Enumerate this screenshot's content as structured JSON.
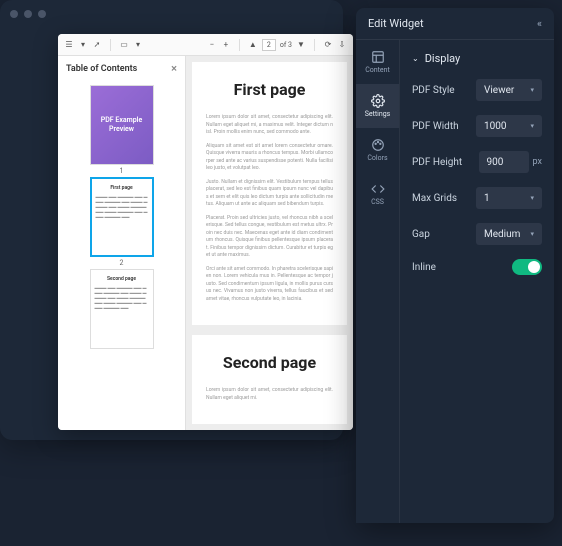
{
  "pdf_viewer": {
    "toolbar": {
      "page_current": "2",
      "page_total": "of 3"
    },
    "toc": {
      "title": "Table of Contents",
      "thumbs": [
        {
          "title": "PDF Example Preview",
          "num": "1",
          "cover": true
        },
        {
          "title": "First page",
          "num": "2",
          "selected": true
        },
        {
          "title": "Second page",
          "num": "3"
        }
      ]
    },
    "pages": [
      {
        "heading": "First page"
      },
      {
        "heading": "Second page"
      }
    ]
  },
  "edit_widget": {
    "title": "Edit Widget",
    "tabs": [
      {
        "id": "content",
        "label": "Content"
      },
      {
        "id": "settings",
        "label": "Settings",
        "active": true
      },
      {
        "id": "colors",
        "label": "Colors"
      },
      {
        "id": "css",
        "label": "CSS"
      }
    ],
    "section": "Display",
    "fields": {
      "pdf_style": {
        "label": "PDF Style",
        "value": "Viewer"
      },
      "pdf_width": {
        "label": "PDF Width",
        "value": "1000"
      },
      "pdf_height": {
        "label": "PDF Height",
        "value": "900",
        "unit": "px"
      },
      "max_grids": {
        "label": "Max Grids",
        "value": "1"
      },
      "gap": {
        "label": "Gap",
        "value": "Medium"
      },
      "inline": {
        "label": "Inline",
        "value": true
      }
    }
  },
  "colors": {
    "accent": "#10b981",
    "panel_bg": "#1d2838",
    "control_bg": "#2d3748"
  }
}
